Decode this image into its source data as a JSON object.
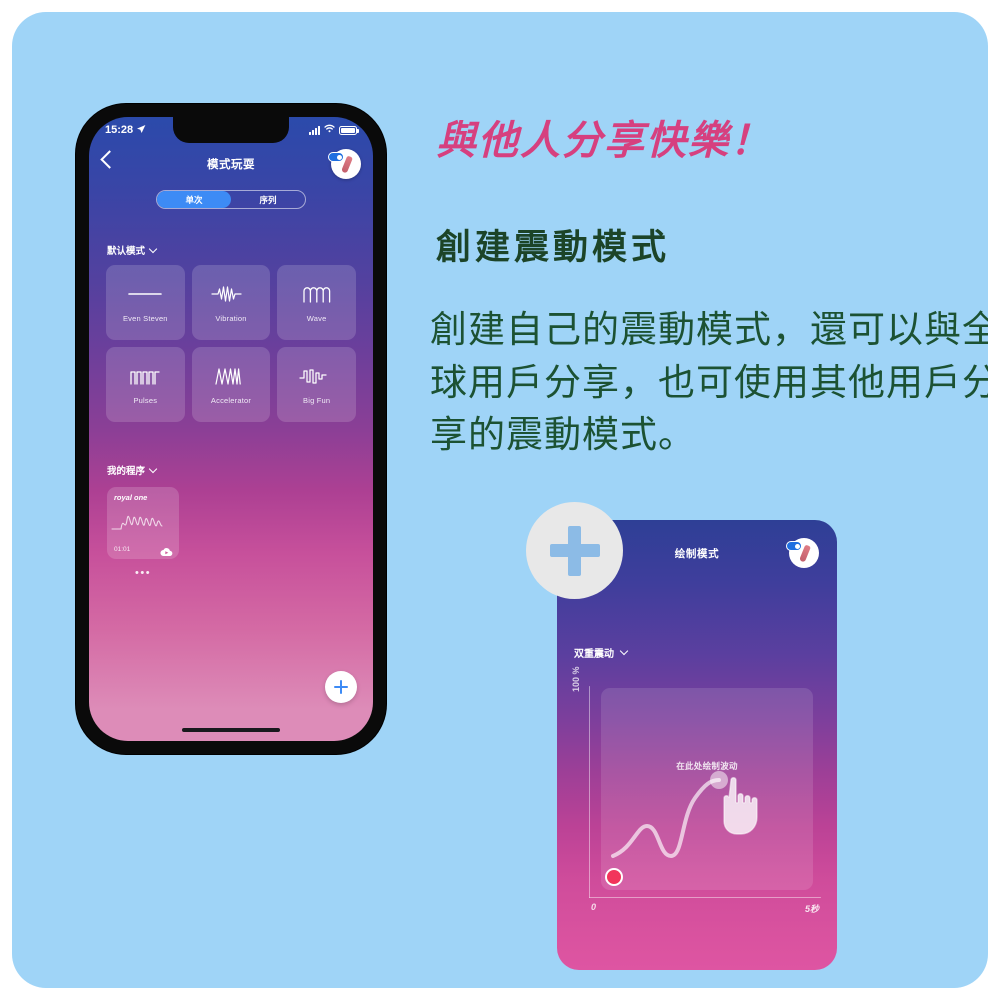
{
  "page": {
    "background_color": "#9fd4f7",
    "outer_color": "#ffffff"
  },
  "marketing": {
    "headline": "與他人分享快樂！",
    "headline_color": "#d6407f",
    "subhead": "創建震動模式",
    "subhead_color": "#1c4428",
    "body": "創建自己的震動模式，還可以與全球用戶分享，也可使用其他用戶分享的震動模式。",
    "body_color": "#1c5233"
  },
  "phone": {
    "status_bar": {
      "time": "15:28",
      "location_icon": "location-arrow-icon",
      "signal_icon": "cellular-signal-icon",
      "wifi_icon": "wifi-icon",
      "battery_icon": "battery-icon"
    },
    "nav": {
      "back_icon": "back-chevron-icon",
      "title": "模式玩耍",
      "brand_icon": "brand-toy-badge-icon"
    },
    "segmented_control": {
      "options": [
        {
          "label": "单次",
          "active": true
        },
        {
          "label": "序列",
          "active": false
        }
      ],
      "active_color": "#3d8bf5"
    },
    "sections": {
      "defaults_label": "默认模式",
      "defaults_chevron": "chevron-down-icon",
      "myprograms_label": "我的程序",
      "myprograms_chevron": "chevron-down-icon"
    },
    "patterns": [
      {
        "name": "Even Steven",
        "icon": "flat-line-waveform-icon"
      },
      {
        "name": "Vibration",
        "icon": "vibration-waveform-icon"
      },
      {
        "name": "Wave",
        "icon": "wave-waveform-icon"
      },
      {
        "name": "Pulses",
        "icon": "pulses-square-waveform-icon"
      },
      {
        "name": "Accelerator",
        "icon": "accelerator-waveform-icon"
      },
      {
        "name": "Big Fun",
        "icon": "big-fun-waveform-icon"
      }
    ],
    "my_program": {
      "title": "royal one",
      "duration": "01:01",
      "cloud_icon": "cloud-upload-icon",
      "more_icon": "more-dots-icon",
      "more_label": "•••"
    },
    "fab": {
      "icon": "plus-icon",
      "color": "#3d8bf5"
    },
    "home_indicator": "home-indicator"
  },
  "draw_card": {
    "title": "绘制模式",
    "brand_icon": "brand-toy-badge-icon",
    "dropdown_label": "双重震动",
    "dropdown_chevron": "chevron-down-icon",
    "canvas": {
      "hint": "在此处绘制波动",
      "y_axis_label": "100 %",
      "x_axis_start": "0",
      "x_axis_end": "5秒",
      "start_dot_color": "#f2355b",
      "hand_icon": "hand-pointer-icon",
      "curve_icon": "drawn-waveform-curve"
    },
    "plus_badge": {
      "icon": "plus-icon",
      "circle_color": "#e8e8e8",
      "glyph_color": "#8cbbe6"
    }
  }
}
